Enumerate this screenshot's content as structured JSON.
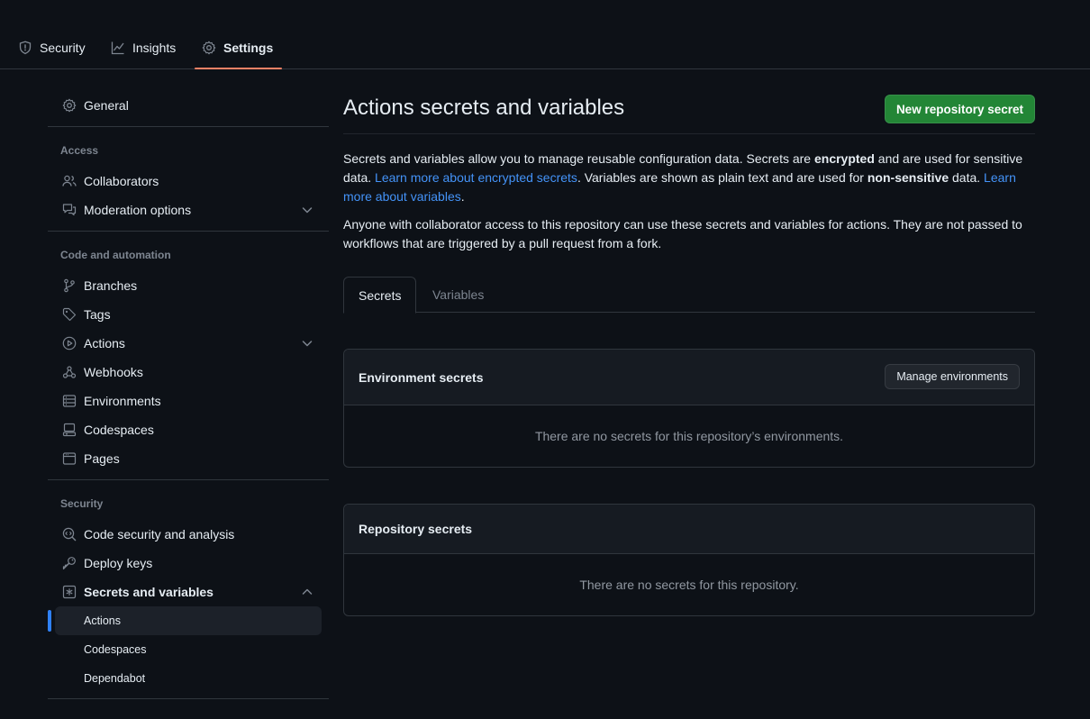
{
  "repo_nav": {
    "tabs": [
      {
        "label": "Security",
        "icon": "shield-icon"
      },
      {
        "label": "Insights",
        "icon": "graph-icon"
      },
      {
        "label": "Settings",
        "icon": "gear-icon",
        "active": true
      }
    ]
  },
  "sidebar": {
    "general": "General",
    "access_heading": "Access",
    "collaborators": "Collaborators",
    "moderation": "Moderation options",
    "code_heading": "Code and automation",
    "branches": "Branches",
    "tags": "Tags",
    "actions": "Actions",
    "webhooks": "Webhooks",
    "environments": "Environments",
    "codespaces": "Codespaces",
    "pages": "Pages",
    "security_heading": "Security",
    "code_security": "Code security and analysis",
    "deploy_keys": "Deploy keys",
    "secrets_vars": "Secrets and variables",
    "sub_actions": "Actions",
    "sub_codespaces": "Codespaces",
    "sub_dependabot": "Dependabot"
  },
  "main": {
    "title": "Actions secrets and variables",
    "new_secret_button": "New repository secret",
    "intro": {
      "p1_a": "Secrets and variables allow you to manage reusable configuration data. Secrets are ",
      "p1_b": "encrypted",
      "p1_c": " and are used for sensitive data. ",
      "p1_link1": "Learn more about encrypted secrets",
      "p1_d": ". Variables are shown as plain text and are used for ",
      "p1_e": "non-sensitive",
      "p1_f": " data. ",
      "p1_link2": "Learn more about variables",
      "p1_g": ".",
      "p2": "Anyone with collaborator access to this repository can use these secrets and variables for actions. They are not passed to workflows that are triggered by a pull request from a fork."
    },
    "tabs": {
      "secrets": "Secrets",
      "variables": "Variables"
    },
    "env_secrets": {
      "title": "Environment secrets",
      "button": "Manage environments",
      "empty": "There are no secrets for this repository’s environments."
    },
    "repo_secrets": {
      "title": "Repository secrets",
      "empty": "There are no secrets for this repository."
    }
  },
  "colors": {
    "background": "#0d1117",
    "accent_underline": "#f78166",
    "primary_button": "#238636",
    "link": "#4493f8",
    "active_indicator": "#2f81f7"
  }
}
